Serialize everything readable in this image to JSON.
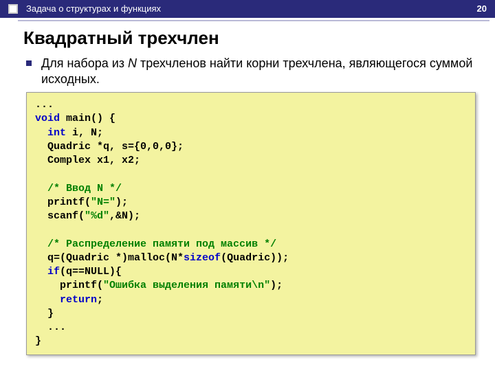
{
  "header": {
    "subject": "Задача о структурах и функциях",
    "page": "20"
  },
  "title": "Квадратный трехчлен",
  "bullet": {
    "pre": "Для набора из ",
    "n": "N",
    "post": " трехчленов найти корни трехчлена, являющегося суммой исходных."
  },
  "code": {
    "l1": "...",
    "l2a": "void",
    "l2b": " main() {",
    "l3a": "  ",
    "l3b": "int",
    "l3c": " i, N;",
    "l4": "  Quadric *q, s={0,0,0};",
    "l5": "  Complex x1, x2;",
    "blank1": "",
    "l6a": "  ",
    "l6b": "/* Ввод N */",
    "l7a": "  printf(",
    "l7b": "\"N=\"",
    "l7c": ");",
    "l8a": "  scanf(",
    "l8b": "\"%d\"",
    "l8c": ",&N);",
    "blank2": "",
    "l9a": "  ",
    "l9b": "/* Распределение памяти под массив */",
    "l10a": "  q=(Quadric *)malloc(N*",
    "l10b": "sizeof",
    "l10c": "(Quadric));",
    "l11a": "  ",
    "l11b": "if",
    "l11c": "(q==NULL){",
    "l12a": "    printf(",
    "l12b": "\"Ошибка выделения памяти\\n\"",
    "l12c": ");",
    "l13a": "    ",
    "l13b": "return",
    "l13c": ";",
    "l14": "  }",
    "l15": "  ...",
    "l16": "}"
  }
}
